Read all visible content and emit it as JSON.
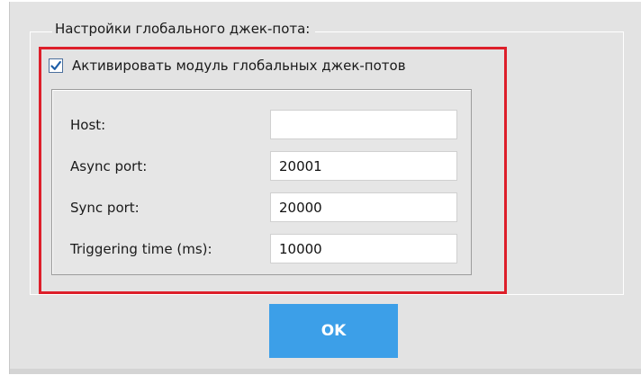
{
  "dialog": {
    "group_title": "Настройки глобального джек-пота:",
    "checkbox": {
      "label": "Активировать модуль глобальных джек-потов",
      "checked": true,
      "check_glyph": "✓"
    },
    "fields": [
      {
        "label": "Host:",
        "value": ""
      },
      {
        "label": "Async port:",
        "value": "20001"
      },
      {
        "label": "Sync port:",
        "value": "20000"
      },
      {
        "label": "Triggering time (ms):",
        "value": "10000"
      }
    ],
    "ok_label": "OK"
  },
  "colors": {
    "dialog_bg": "#e3e3e3",
    "highlight_border": "#dd1f2a",
    "button_bg": "#3c9fe8",
    "check_mark": "#1f5fa8"
  }
}
